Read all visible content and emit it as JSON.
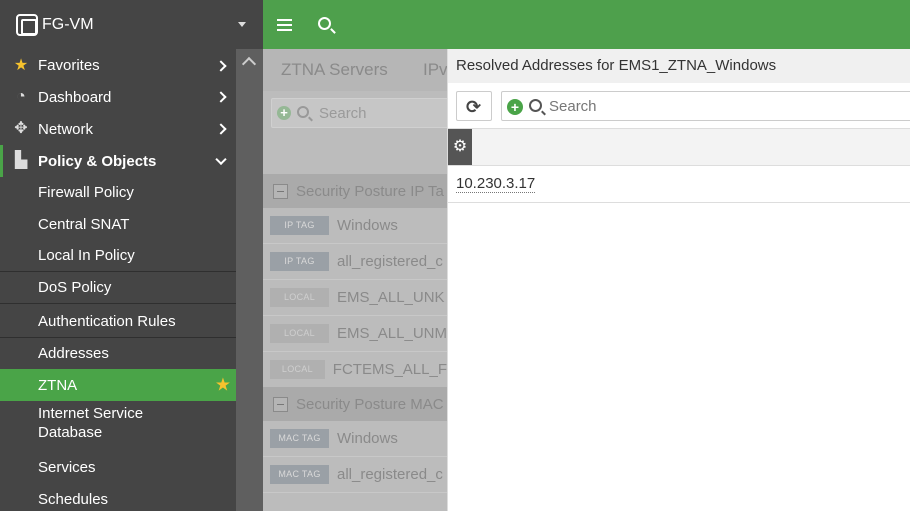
{
  "brand": {
    "title": "FG-VM"
  },
  "sidebar": {
    "items": [
      {
        "label": "Favorites",
        "icon": "star-icon"
      },
      {
        "label": "Dashboard",
        "icon": "dashboard-icon"
      },
      {
        "label": "Network",
        "icon": "network-icon"
      },
      {
        "label": "Policy & Objects",
        "icon": "policy-icon"
      },
      {
        "label": "Firewall Policy"
      },
      {
        "label": "Central SNAT"
      },
      {
        "label": "Local In Policy"
      },
      {
        "label": "DoS Policy"
      },
      {
        "label": "Authentication Rules"
      },
      {
        "label": "Addresses"
      },
      {
        "label": "ZTNA"
      },
      {
        "label": "Internet Service Database"
      },
      {
        "label": "Services"
      },
      {
        "label": "Schedules"
      }
    ]
  },
  "content": {
    "tabs": [
      "ZTNA Servers",
      "IPv"
    ],
    "search_placeholder": "Search",
    "groups": [
      {
        "label": "Security Posture IP Ta"
      },
      {
        "label": "Security Posture MAC"
      }
    ],
    "rows": [
      {
        "badge": "IP TAG",
        "label": "Windows"
      },
      {
        "badge": "IP TAG",
        "label": "all_registered_c"
      },
      {
        "badge": "LOCAL",
        "label": "EMS_ALL_UNK"
      },
      {
        "badge": "LOCAL",
        "label": "EMS_ALL_UNM"
      },
      {
        "badge": "LOCAL",
        "label": "FCTEMS_ALL_F"
      },
      {
        "badge": "MAC TAG",
        "label": "Windows"
      },
      {
        "badge": "MAC TAG",
        "label": "all_registered_c"
      }
    ]
  },
  "panel": {
    "title": "Resolved Addresses for EMS1_ZTNA_Windows",
    "search_placeholder": "Search",
    "addresses": [
      "10.230.3.17"
    ]
  },
  "colors": {
    "accent_green": "#4aa448",
    "sidebar_bg": "#454545",
    "star": "#f6c22d"
  }
}
